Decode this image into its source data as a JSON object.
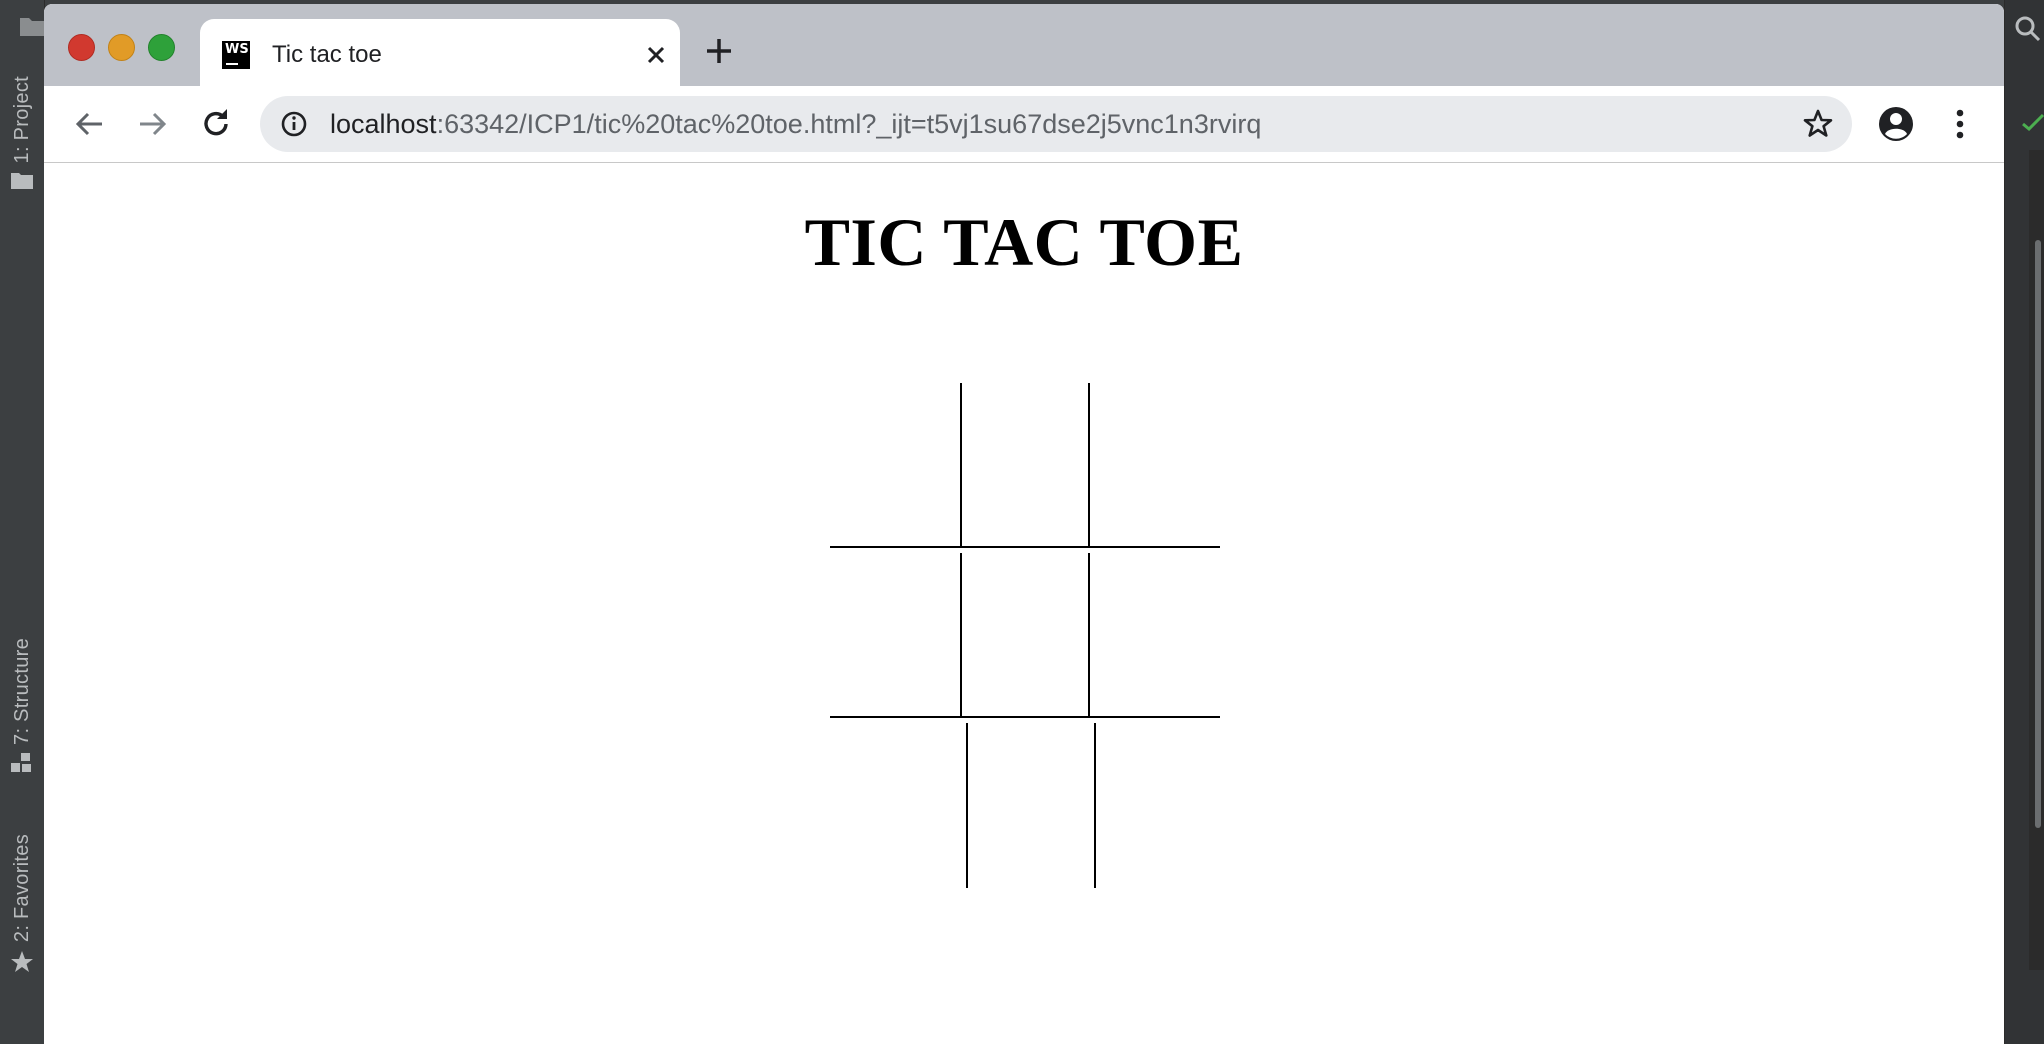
{
  "ide": {
    "left_tabs": [
      {
        "label": "1: Project",
        "mnemonic": "1"
      },
      {
        "label": "7: Structure",
        "mnemonic": "7"
      },
      {
        "label": "2: Favorites",
        "mnemonic": "2"
      }
    ]
  },
  "browser": {
    "tab": {
      "title": "Tic tac toe",
      "favicon_text": "WS"
    },
    "url": {
      "host": "localhost",
      "rest": ":63342/ICP1/tic%20tac%20toe.html?_ijt=t5vj1su67dse2j5vnc1n3rvirq"
    }
  },
  "page": {
    "heading": "TIC TAC TOE",
    "board": {
      "rows": 3,
      "cols": 3,
      "cells": [
        "",
        "",
        "",
        "",
        "",
        "",
        "",
        "",
        ""
      ]
    }
  },
  "icons": {
    "back": "arrow-left-icon",
    "forward": "arrow-right-icon",
    "reload": "reload-icon",
    "info": "info-icon",
    "bookmark": "star-icon",
    "profile": "account-circle-icon",
    "menu": "more-vert-icon",
    "new_tab": "plus-icon",
    "close_tab": "close-icon"
  },
  "colors": {
    "tabstrip": "#bec1c8",
    "omnibox": "#e8eaed",
    "ide_background": "#3c3f41",
    "traffic_close": "#d1392f",
    "traffic_minimize": "#e19b27",
    "traffic_maximize": "#2ea13a"
  }
}
